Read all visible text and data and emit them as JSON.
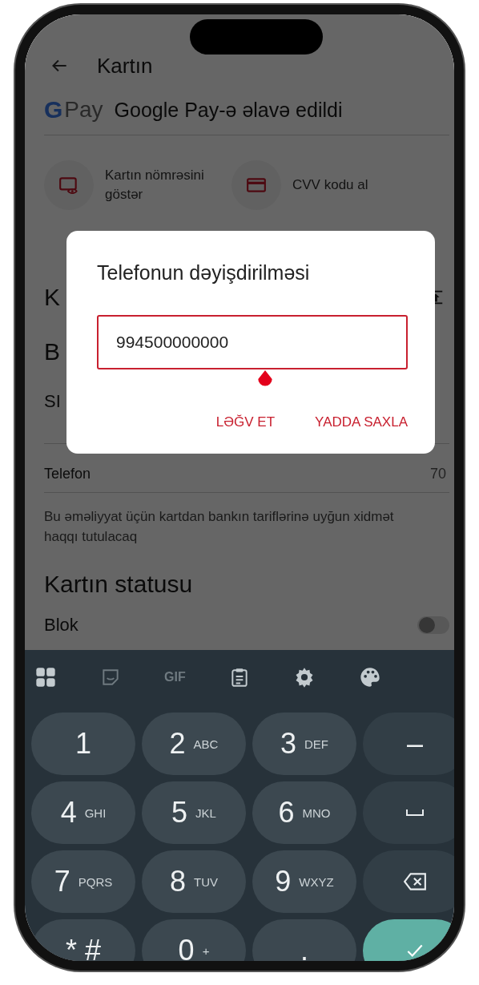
{
  "header": {
    "title": "Kartın"
  },
  "gpay": {
    "logo_g": "G",
    "logo_pay": "Pay",
    "text": "Google Pay-ə əlavə edildi"
  },
  "actions": [
    {
      "kind": "show-number",
      "label": "Kartın nömrəsini göstər"
    },
    {
      "kind": "cvv",
      "label": "CVV kodu al"
    }
  ],
  "covered": [
    {
      "kind": "heading",
      "text": "K"
    },
    {
      "kind": "heading",
      "text": "B"
    },
    {
      "kind": "row",
      "text": "SI"
    }
  ],
  "phone_row": {
    "label": "Telefon",
    "value": "70"
  },
  "note": "Bu əməliyyat üçün kartdan bankın tariflərinə uyğun xidmət haqqı tutulacaq",
  "status_section": {
    "title": "Kartın statusu",
    "rows": [
      {
        "label": "Blok",
        "on": false
      }
    ]
  },
  "dialog": {
    "title": "Telefonun dəyişdirilməsi",
    "value": "994500000000",
    "focused": true,
    "buttons": [
      "LƏĞV ET",
      "YADDA SAXLA"
    ]
  },
  "keyboard": {
    "toolbar": [
      {
        "kind": "apps"
      },
      {
        "kind": "sticker"
      },
      {
        "kind": "gif",
        "label": "GIF"
      },
      {
        "kind": "clipboard"
      },
      {
        "kind": "settings"
      },
      {
        "kind": "palette"
      }
    ],
    "keys": [
      {
        "kind": "char",
        "main": "1"
      },
      {
        "kind": "char",
        "main": "2",
        "sub": "ABC"
      },
      {
        "kind": "char",
        "main": "3",
        "sub": "DEF"
      },
      {
        "kind": "char",
        "main": "–"
      },
      {
        "kind": "char",
        "main": "4",
        "sub": "GHI"
      },
      {
        "kind": "char",
        "main": "5",
        "sub": "JKL"
      },
      {
        "kind": "char",
        "main": "6",
        "sub": "MNO"
      },
      {
        "kind": "space"
      },
      {
        "kind": "char",
        "main": "7",
        "sub": "PQRS"
      },
      {
        "kind": "char",
        "main": "8",
        "sub": "TUV"
      },
      {
        "kind": "char",
        "main": "9",
        "sub": "WXYZ"
      },
      {
        "kind": "backspace"
      },
      {
        "kind": "char",
        "main": "* #"
      },
      {
        "kind": "char",
        "main": "0",
        "sub": "+"
      },
      {
        "kind": "char",
        "main": "."
      },
      {
        "kind": "enter"
      }
    ]
  }
}
